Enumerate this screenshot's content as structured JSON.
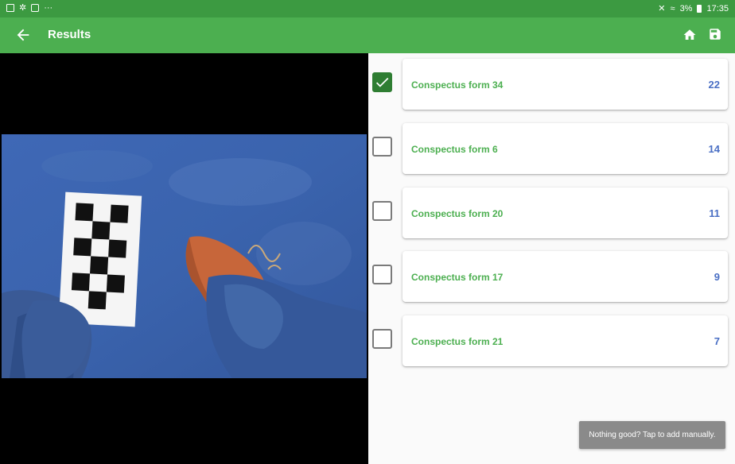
{
  "status_bar": {
    "left_icons": [
      "image-icon",
      "settings-icon",
      "tablet-icon"
    ],
    "overflow": "···",
    "battery": "3%",
    "time": "17:35"
  },
  "app_bar": {
    "title": "Results",
    "actions": [
      "home-icon",
      "save-icon"
    ]
  },
  "results": [
    {
      "label": "Conspectus form 34",
      "score": "22",
      "checked": true
    },
    {
      "label": "Conspectus form 6",
      "score": "14",
      "checked": false
    },
    {
      "label": "Conspectus form 20",
      "score": "11",
      "checked": false
    },
    {
      "label": "Conspectus form 17",
      "score": "9",
      "checked": false
    },
    {
      "label": "Conspectus form 21",
      "score": "7",
      "checked": false
    }
  ],
  "snackbar": {
    "text": "Nothing good? Tap to add manually."
  },
  "colors": {
    "status_bar": "#3c9a41",
    "app_bar": "#4caf50",
    "result_label": "#4caf50",
    "result_score": "#4a6fc4",
    "checkbox_checked": "#2e7d32"
  }
}
